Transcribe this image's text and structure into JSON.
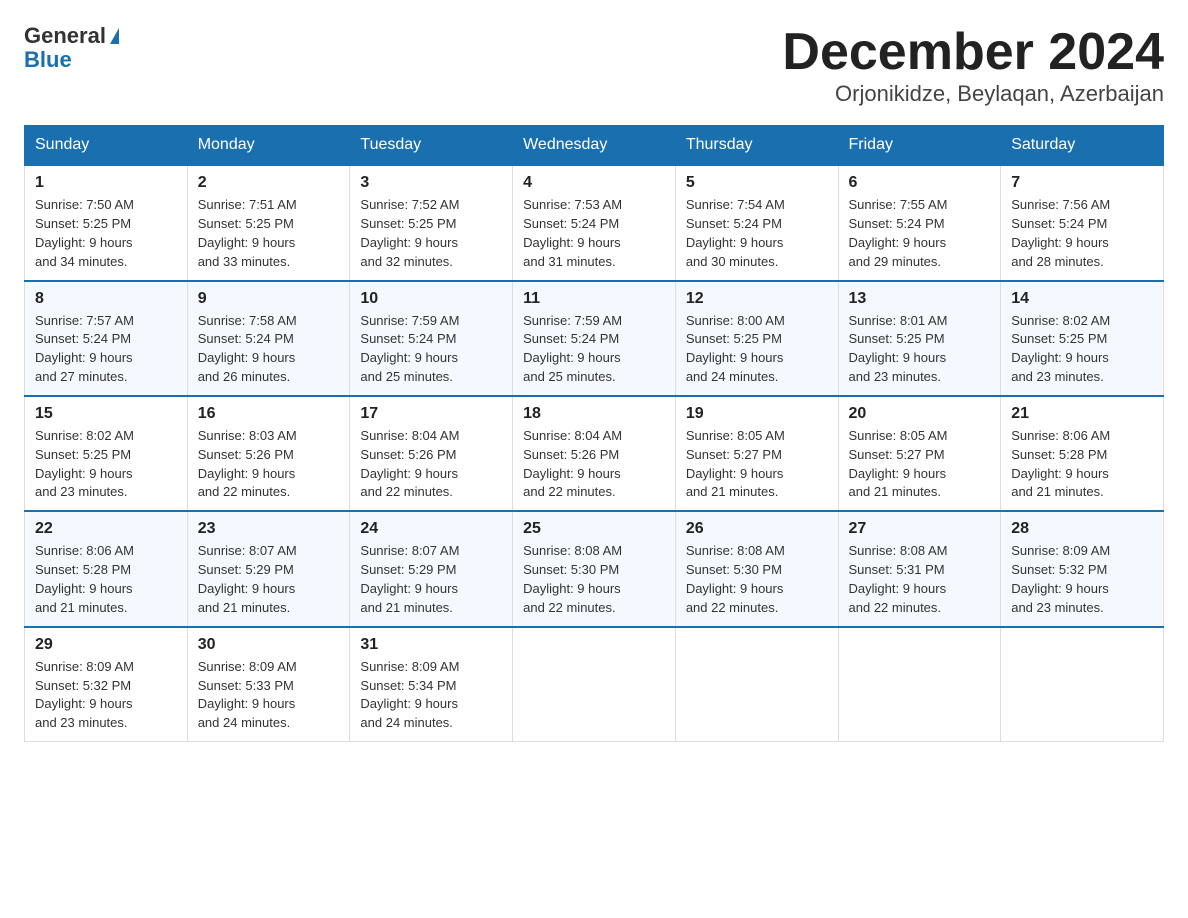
{
  "header": {
    "title": "December 2024",
    "subtitle": "Orjonikidze, Beylaqan, Azerbaijan",
    "logo_line1": "General",
    "logo_line2": "Blue"
  },
  "days_of_week": [
    "Sunday",
    "Monday",
    "Tuesday",
    "Wednesday",
    "Thursday",
    "Friday",
    "Saturday"
  ],
  "weeks": [
    [
      {
        "day": "1",
        "sunrise": "7:50 AM",
        "sunset": "5:25 PM",
        "daylight": "9 hours and 34 minutes."
      },
      {
        "day": "2",
        "sunrise": "7:51 AM",
        "sunset": "5:25 PM",
        "daylight": "9 hours and 33 minutes."
      },
      {
        "day": "3",
        "sunrise": "7:52 AM",
        "sunset": "5:25 PM",
        "daylight": "9 hours and 32 minutes."
      },
      {
        "day": "4",
        "sunrise": "7:53 AM",
        "sunset": "5:24 PM",
        "daylight": "9 hours and 31 minutes."
      },
      {
        "day": "5",
        "sunrise": "7:54 AM",
        "sunset": "5:24 PM",
        "daylight": "9 hours and 30 minutes."
      },
      {
        "day": "6",
        "sunrise": "7:55 AM",
        "sunset": "5:24 PM",
        "daylight": "9 hours and 29 minutes."
      },
      {
        "day": "7",
        "sunrise": "7:56 AM",
        "sunset": "5:24 PM",
        "daylight": "9 hours and 28 minutes."
      }
    ],
    [
      {
        "day": "8",
        "sunrise": "7:57 AM",
        "sunset": "5:24 PM",
        "daylight": "9 hours and 27 minutes."
      },
      {
        "day": "9",
        "sunrise": "7:58 AM",
        "sunset": "5:24 PM",
        "daylight": "9 hours and 26 minutes."
      },
      {
        "day": "10",
        "sunrise": "7:59 AM",
        "sunset": "5:24 PM",
        "daylight": "9 hours and 25 minutes."
      },
      {
        "day": "11",
        "sunrise": "7:59 AM",
        "sunset": "5:24 PM",
        "daylight": "9 hours and 25 minutes."
      },
      {
        "day": "12",
        "sunrise": "8:00 AM",
        "sunset": "5:25 PM",
        "daylight": "9 hours and 24 minutes."
      },
      {
        "day": "13",
        "sunrise": "8:01 AM",
        "sunset": "5:25 PM",
        "daylight": "9 hours and 23 minutes."
      },
      {
        "day": "14",
        "sunrise": "8:02 AM",
        "sunset": "5:25 PM",
        "daylight": "9 hours and 23 minutes."
      }
    ],
    [
      {
        "day": "15",
        "sunrise": "8:02 AM",
        "sunset": "5:25 PM",
        "daylight": "9 hours and 23 minutes."
      },
      {
        "day": "16",
        "sunrise": "8:03 AM",
        "sunset": "5:26 PM",
        "daylight": "9 hours and 22 minutes."
      },
      {
        "day": "17",
        "sunrise": "8:04 AM",
        "sunset": "5:26 PM",
        "daylight": "9 hours and 22 minutes."
      },
      {
        "day": "18",
        "sunrise": "8:04 AM",
        "sunset": "5:26 PM",
        "daylight": "9 hours and 22 minutes."
      },
      {
        "day": "19",
        "sunrise": "8:05 AM",
        "sunset": "5:27 PM",
        "daylight": "9 hours and 21 minutes."
      },
      {
        "day": "20",
        "sunrise": "8:05 AM",
        "sunset": "5:27 PM",
        "daylight": "9 hours and 21 minutes."
      },
      {
        "day": "21",
        "sunrise": "8:06 AM",
        "sunset": "5:28 PM",
        "daylight": "9 hours and 21 minutes."
      }
    ],
    [
      {
        "day": "22",
        "sunrise": "8:06 AM",
        "sunset": "5:28 PM",
        "daylight": "9 hours and 21 minutes."
      },
      {
        "day": "23",
        "sunrise": "8:07 AM",
        "sunset": "5:29 PM",
        "daylight": "9 hours and 21 minutes."
      },
      {
        "day": "24",
        "sunrise": "8:07 AM",
        "sunset": "5:29 PM",
        "daylight": "9 hours and 21 minutes."
      },
      {
        "day": "25",
        "sunrise": "8:08 AM",
        "sunset": "5:30 PM",
        "daylight": "9 hours and 22 minutes."
      },
      {
        "day": "26",
        "sunrise": "8:08 AM",
        "sunset": "5:30 PM",
        "daylight": "9 hours and 22 minutes."
      },
      {
        "day": "27",
        "sunrise": "8:08 AM",
        "sunset": "5:31 PM",
        "daylight": "9 hours and 22 minutes."
      },
      {
        "day": "28",
        "sunrise": "8:09 AM",
        "sunset": "5:32 PM",
        "daylight": "9 hours and 23 minutes."
      }
    ],
    [
      {
        "day": "29",
        "sunrise": "8:09 AM",
        "sunset": "5:32 PM",
        "daylight": "9 hours and 23 minutes."
      },
      {
        "day": "30",
        "sunrise": "8:09 AM",
        "sunset": "5:33 PM",
        "daylight": "9 hours and 24 minutes."
      },
      {
        "day": "31",
        "sunrise": "8:09 AM",
        "sunset": "5:34 PM",
        "daylight": "9 hours and 24 minutes."
      },
      null,
      null,
      null,
      null
    ]
  ],
  "labels": {
    "sunrise": "Sunrise:",
    "sunset": "Sunset:",
    "daylight": "Daylight:"
  }
}
